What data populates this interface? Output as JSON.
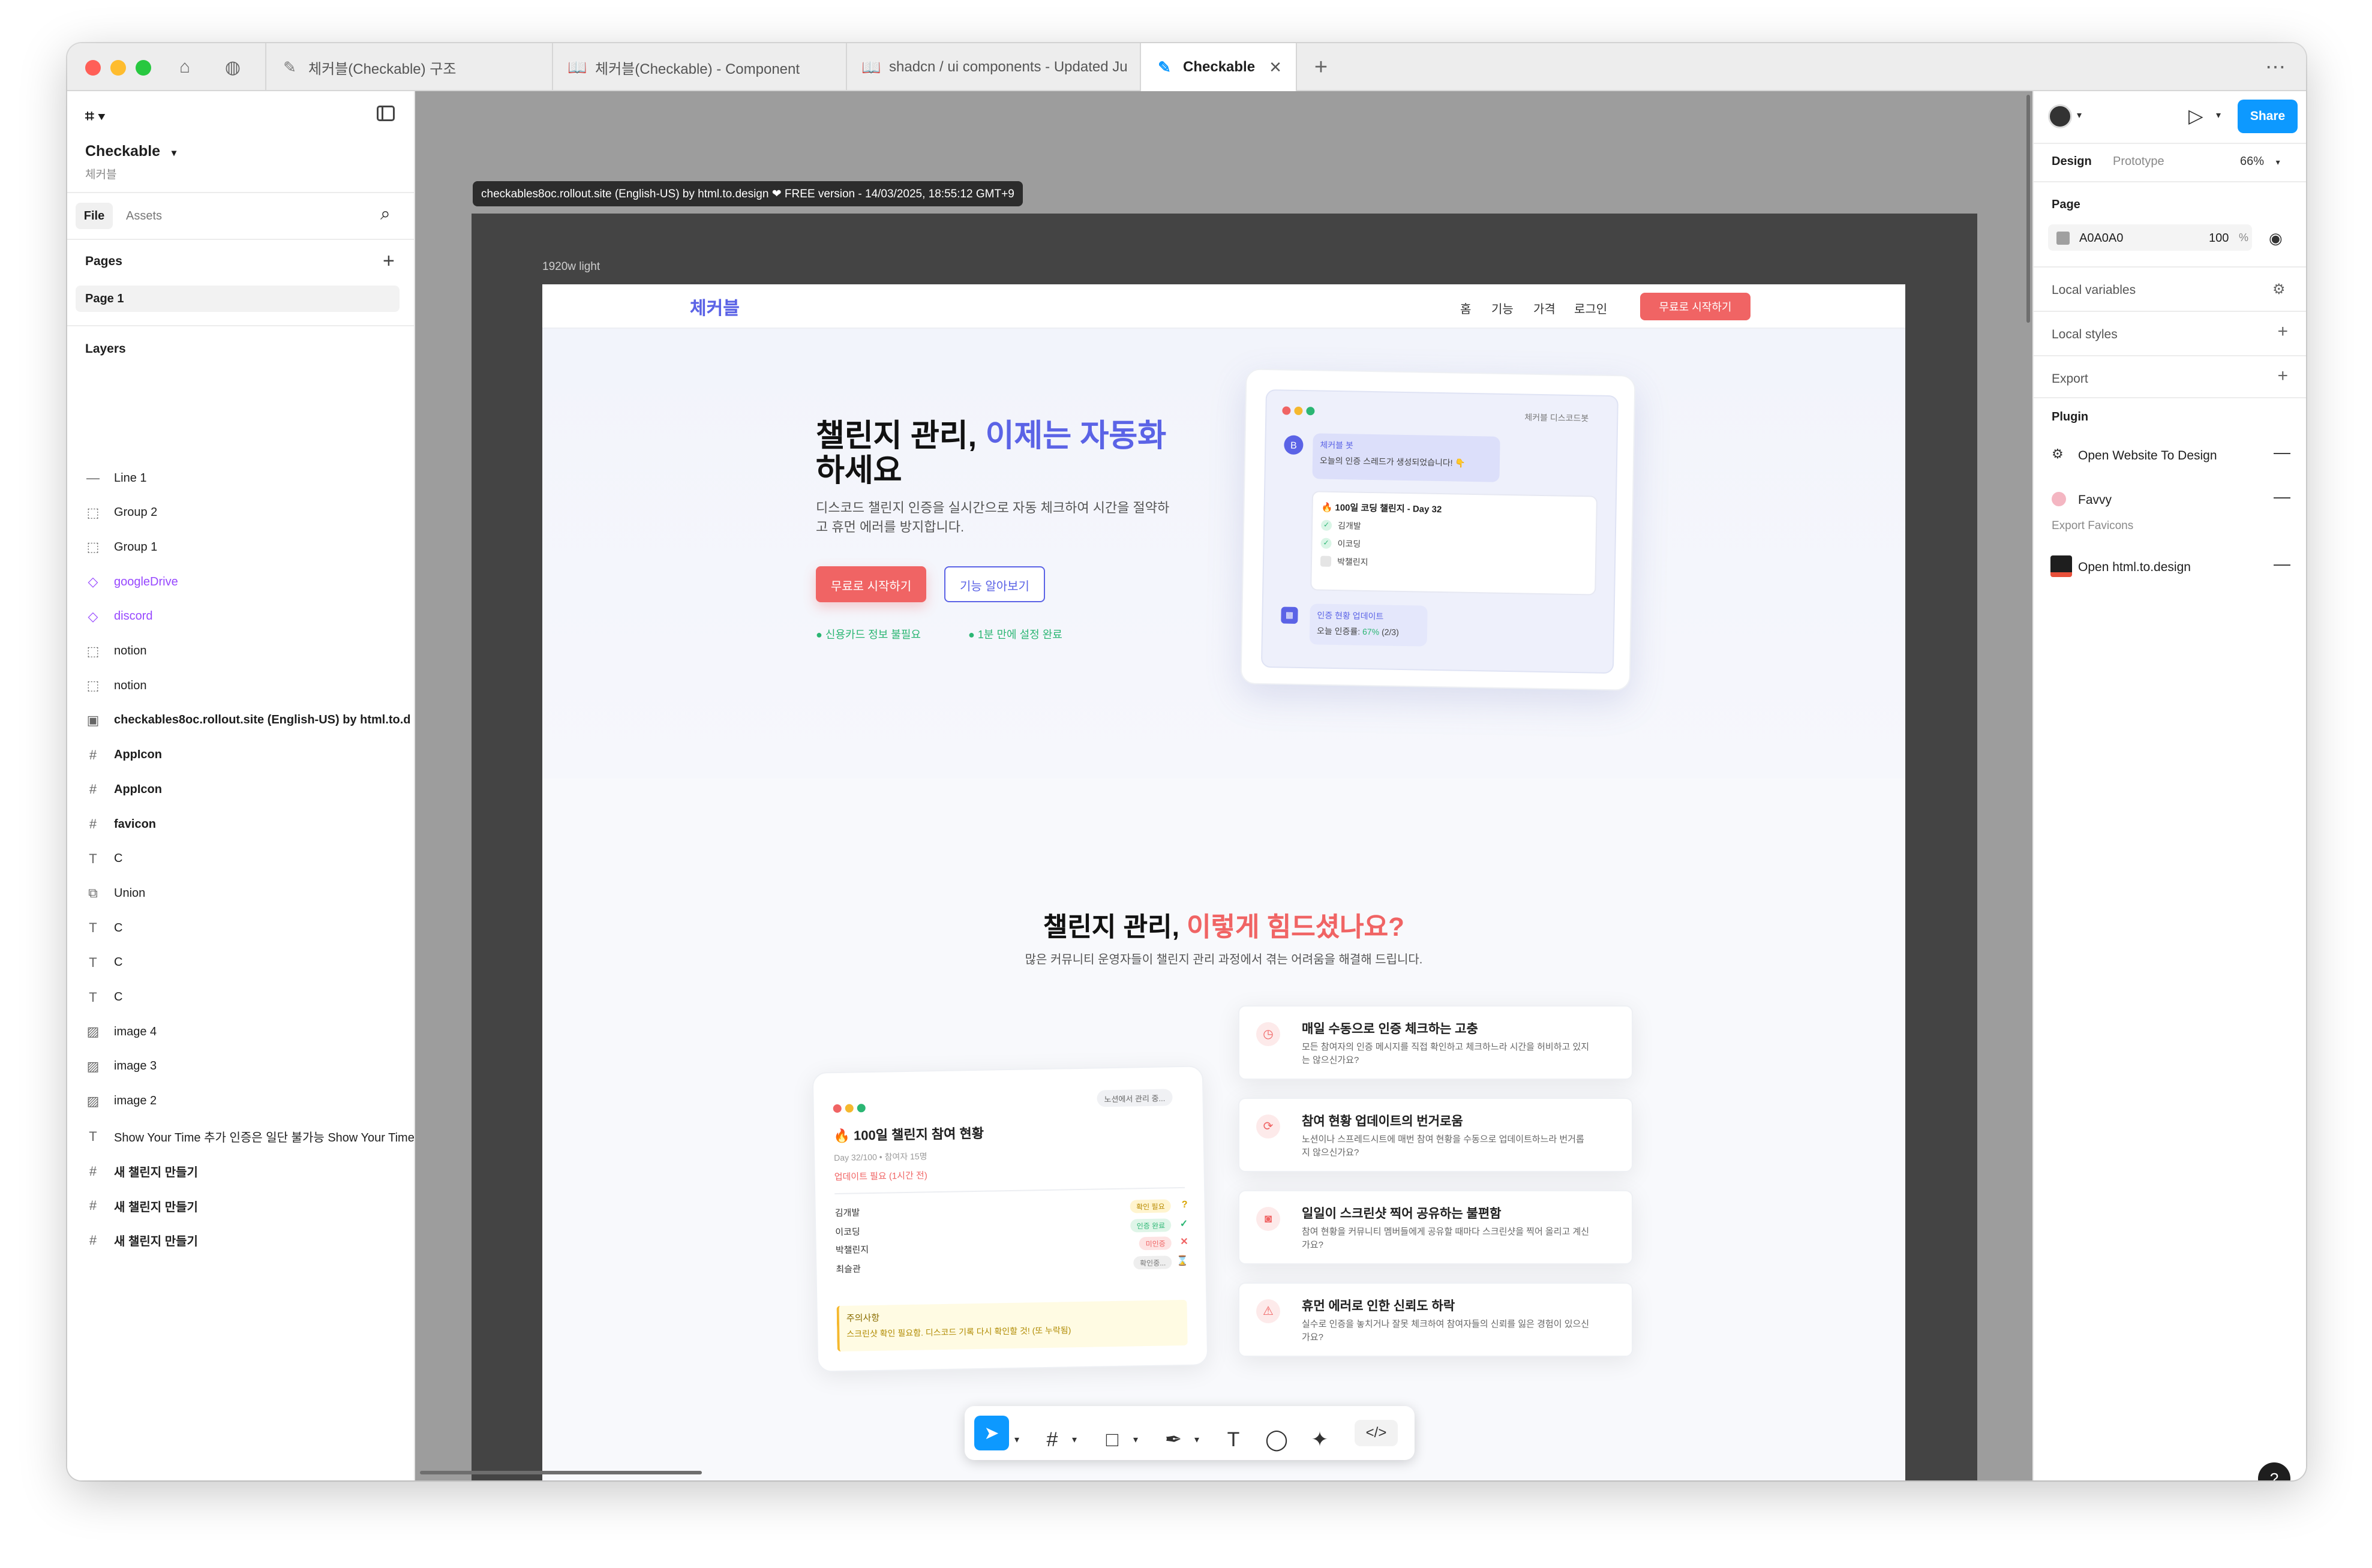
{
  "browser": {
    "tabs": [
      {
        "label": "체커블(Checkable) 구조",
        "icon": "pen-tool-icon"
      },
      {
        "label": "체커블(Checkable) - Component",
        "icon": "book-icon"
      },
      {
        "label": "shadcn / ui components - Updated Ju",
        "icon": "book-icon"
      },
      {
        "label": "Checkable",
        "icon": "figma-file-icon"
      }
    ]
  },
  "left_panel": {
    "file_name": "Checkable",
    "file_subtitle": "체커블",
    "tab_file": "File",
    "tab_assets": "Assets",
    "pages_heading": "Pages",
    "page_item": "Page 1",
    "layers_heading": "Layers",
    "layers": [
      {
        "name": "Line 1",
        "icon": "line-icon",
        "glyph": "—",
        "purple": false,
        "bold": false
      },
      {
        "name": "Group 2",
        "icon": "group-icon",
        "glyph": "⬚",
        "purple": false,
        "bold": false
      },
      {
        "name": "Group 1",
        "icon": "group-icon",
        "glyph": "⬚",
        "purple": false,
        "bold": false
      },
      {
        "name": "googleDrive",
        "icon": "component-icon",
        "glyph": "◇",
        "purple": true,
        "bold": false
      },
      {
        "name": "discord",
        "icon": "component-icon",
        "glyph": "◇",
        "purple": true,
        "bold": false
      },
      {
        "name": "notion",
        "icon": "group-icon",
        "glyph": "⬚",
        "purple": false,
        "bold": false
      },
      {
        "name": "notion",
        "icon": "group-icon",
        "glyph": "⬚",
        "purple": false,
        "bold": false
      },
      {
        "name": "checkables8oc.rollout.site (English-US) by html.to.d",
        "icon": "frame-icon",
        "glyph": "▣",
        "purple": false,
        "bold": true
      },
      {
        "name": "AppIcon",
        "icon": "frame-hash-icon",
        "glyph": "#",
        "purple": false,
        "bold": true
      },
      {
        "name": "AppIcon",
        "icon": "frame-hash-icon",
        "glyph": "#",
        "purple": false,
        "bold": true
      },
      {
        "name": "favicon",
        "icon": "frame-hash-icon",
        "glyph": "#",
        "purple": false,
        "bold": true
      },
      {
        "name": "C",
        "icon": "text-icon",
        "glyph": "T",
        "purple": false,
        "bold": false
      },
      {
        "name": "Union",
        "icon": "union-icon",
        "glyph": "⧉",
        "purple": false,
        "bold": false
      },
      {
        "name": "C",
        "icon": "text-icon",
        "glyph": "T",
        "purple": false,
        "bold": false
      },
      {
        "name": "C",
        "icon": "text-icon",
        "glyph": "T",
        "purple": false,
        "bold": false
      },
      {
        "name": "C",
        "icon": "text-icon",
        "glyph": "T",
        "purple": false,
        "bold": false
      },
      {
        "name": "image 4",
        "icon": "image-icon",
        "glyph": "▨",
        "purple": false,
        "bold": false
      },
      {
        "name": "image 3",
        "icon": "image-icon",
        "glyph": "▨",
        "purple": false,
        "bold": false
      },
      {
        "name": "image 2",
        "icon": "image-icon",
        "glyph": "▨",
        "purple": false,
        "bold": false
      },
      {
        "name": "Show Your Time 추가 인증은 일단 불가능 Show Your Time",
        "icon": "text-icon",
        "glyph": "T",
        "purple": false,
        "bold": false
      },
      {
        "name": "새 챌린지 만들기",
        "icon": "frame-hash-icon",
        "glyph": "#",
        "purple": false,
        "bold": true
      },
      {
        "name": "새 챌린지 만들기",
        "icon": "frame-hash-icon",
        "glyph": "#",
        "purple": false,
        "bold": true
      },
      {
        "name": "새 챌린지 만들기",
        "icon": "frame-hash-icon",
        "glyph": "#",
        "purple": false,
        "bold": true
      }
    ]
  },
  "canvas": {
    "frame_tag": "checkables8oc.rollout.site (English-US) by html.to.design ❤ FREE version - 14/03/2025, 18:55:12 GMT+9",
    "frame_label": "1920w light"
  },
  "site": {
    "logo": "체커블",
    "nav": [
      "홈",
      "기능",
      "가격",
      "로그인"
    ],
    "nav_cta": "무료로 시작하기",
    "hero_title_1": "챌린지 관리, ",
    "hero_title_accent": "이제는 자동화",
    "hero_title_2": "하세요",
    "hero_desc": "디스코드 챌린지 인증을 실시간으로 자동 체크하여 시간을 절약하고 휴먼 에러를 방지합니다.",
    "hero_cta_primary": "무료로 시작하기",
    "hero_cta_secondary": "기능 알아보기",
    "hero_check_1": "신용카드 정보 불필요",
    "hero_check_2": "1분 만에 설정 완료",
    "mock": {
      "label": "체커블 디스코드봇",
      "avatar": "B",
      "bot_name": "체커블 봇",
      "bot_msg": "오늘의 인증 스레드가 생성되었습니다! 👇",
      "challenge_title": "🔥 100일 코딩 챌린지 - Day 32",
      "members": [
        {
          "name": "김개발",
          "done": true
        },
        {
          "name": "이코딩",
          "done": true
        },
        {
          "name": "박챌린지",
          "done": false
        }
      ],
      "status_title": "인증 현황 업데이트",
      "status_prefix": "오늘 인증률: ",
      "status_pct": "67%",
      "status_count": "(2/3)"
    },
    "problem_title_1": "챌린지 관리, ",
    "problem_title_accent": "이렇게 힘드셨나요?",
    "problem_sub": "많은 커뮤니티 운영자들이 챌린지 관리 과정에서 겪는 어려움을 해결해 드립니다.",
    "table_card": {
      "tag": "노션에서 관리 중...",
      "title": "🔥 100일 챌린지 참여 현황",
      "meta_day": "Day 32/100",
      "meta_sep": "•",
      "meta_count": "참여자 15명",
      "update_notice": "업데이트 필요 (1시간 전)",
      "rows": [
        {
          "name": "김개발",
          "status": "확인 필요",
          "mark": "?",
          "mark_icon": "question-icon"
        },
        {
          "name": "이코딩",
          "status": "인증 완료",
          "mark": "✓",
          "mark_icon": "check-icon"
        },
        {
          "name": "박챌린지",
          "status": "미인증",
          "mark": "✕",
          "mark_icon": "x-icon"
        },
        {
          "name": "최슬관",
          "status": "확인중...",
          "mark": "⌛",
          "mark_icon": "hourglass-icon"
        }
      ],
      "note_title": "주의사항",
      "note_body": "스크린샷 확인 필요함. 디스코드 기록 다시 확인할 것! (또 누락됨)"
    },
    "problems": [
      {
        "icon": "clock-icon",
        "glyph": "◷",
        "title": "매일 수동으로 인증 체크하는 고충",
        "desc": "모든 참여자의 인증 메시지를 직접 확인하고 체크하느라 시간을 허비하고 있지는 않으신가요?"
      },
      {
        "icon": "refresh-icon",
        "glyph": "⟳",
        "title": "참여 현황 업데이트의 번거로움",
        "desc": "노션이나 스프레드시트에 매번 참여 현황을 수동으로 업데이트하느라 번거롭지 않으신가요?"
      },
      {
        "icon": "camera-icon",
        "glyph": "◙",
        "title": "일일이 스크린샷 찍어 공유하는 불편함",
        "desc": "참여 현황을 커뮤니티 멤버들에게 공유할 때마다 스크린샷을 찍어 올리고 계신가요?"
      },
      {
        "icon": "warning-icon",
        "glyph": "⚠",
        "title": "휴먼 에러로 인한 신뢰도 하락",
        "desc": "실수로 인증을 놓치거나 잘못 체크하여 참여자들의 신뢰를 잃은 경험이 있으신가요?"
      }
    ]
  },
  "right_panel": {
    "share": "Share",
    "tab_design": "Design",
    "tab_prototype": "Prototype",
    "zoom": "66%",
    "page_heading": "Page",
    "page_color": "A0A0A0",
    "page_opacity": "100",
    "page_opacity_unit": "%",
    "local_variables": "Local variables",
    "local_styles": "Local styles",
    "export": "Export",
    "plugin_heading": "Plugin",
    "plugins": [
      {
        "name": "Open Website To Design",
        "sub": ""
      },
      {
        "name": "Favvy",
        "sub": "Export Favicons"
      },
      {
        "name": "Open html.to.design",
        "sub": ""
      }
    ]
  },
  "colors": {
    "accent_blue": "#0d99ff",
    "site_indigo": "#5b63e6",
    "site_coral": "#f06464",
    "site_green": "#2bb673",
    "canvas_bg": "#9d9d9d"
  }
}
